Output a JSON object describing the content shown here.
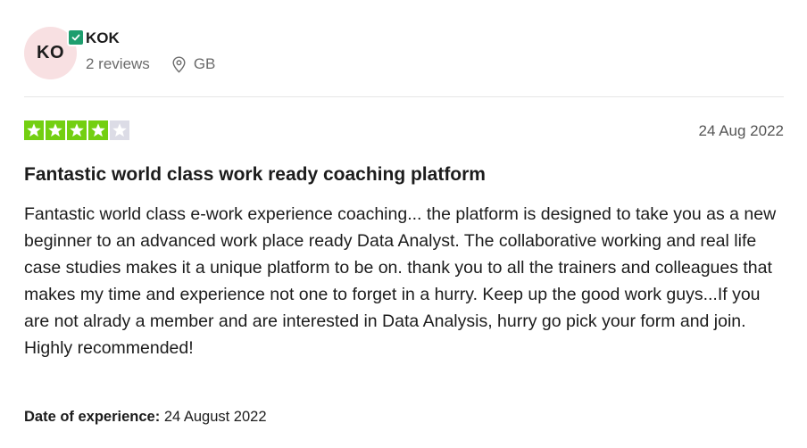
{
  "reviewer": {
    "initials": "KO",
    "name": "KOK",
    "review_count": "2 reviews",
    "country": "GB",
    "verified_icon": "check-badge-icon",
    "location_icon": "location-pin-icon"
  },
  "review": {
    "rating": 4,
    "max_rating": 5,
    "date": "24 Aug 2022",
    "title": "Fantastic world class work ready coaching platform",
    "body": "Fantastic world class e-work experience coaching... the platform is designed to take you as a new beginner to an advanced work place ready Data Analyst. The collaborative working and real life case studies makes it a unique platform to be on. thank you to all the trainers and colleagues that makes my time and experience not one to forget in a hurry. Keep up the good work guys...If you are not alrady a member and are interested in Data Analysis, hurry go pick your form and join. Highly recommended!",
    "experience_label": "Date of experience:",
    "experience_date": "24 August 2022"
  },
  "colors": {
    "star_filled": "#73cf11",
    "star_empty": "#dcdce6",
    "avatar_bg": "#f8e0e2",
    "verified": "#1e9e6e"
  }
}
